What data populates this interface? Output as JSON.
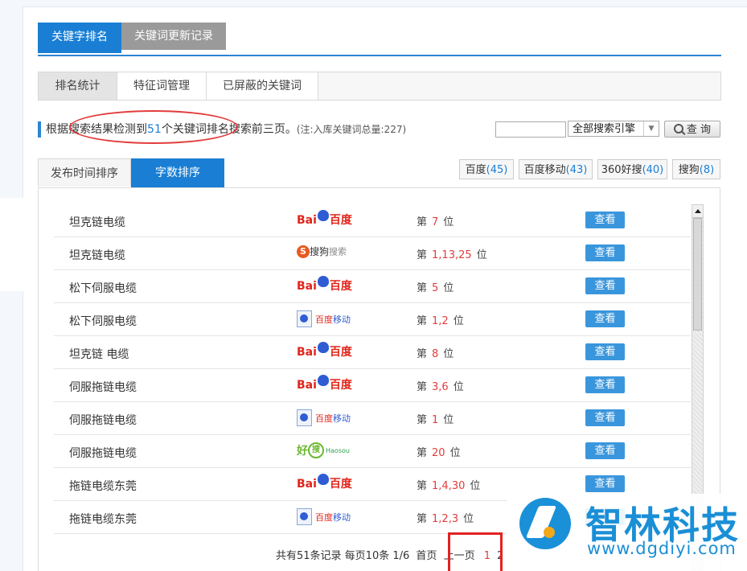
{
  "main_tabs": [
    {
      "label": "关键字排名"
    },
    {
      "label": "关键词更新记录"
    }
  ],
  "sub_tabs": [
    {
      "label": "排名统计"
    },
    {
      "label": "特征词管理"
    },
    {
      "label": "已屏蔽的关键词"
    }
  ],
  "info": {
    "prefix": "根据搜索结果检测到",
    "count": "51",
    "suffix": "个关键词排名搜索前三页。",
    "note": "(注:入库关键词总量:227)"
  },
  "search": {
    "keyword_value": "",
    "engine_selected": "全部搜索引擎",
    "button_label": "查 询"
  },
  "sort_tabs": [
    {
      "label": "发布时间排序"
    },
    {
      "label": "字数排序"
    }
  ],
  "engine_filters": [
    {
      "name": "百度",
      "count": "(45)"
    },
    {
      "name": "百度移动",
      "count": "(43)"
    },
    {
      "name": "360好搜",
      "count": "(40)"
    },
    {
      "name": "搜狗",
      "count": "(8)"
    }
  ],
  "logos": {
    "baidu": {
      "left": "Bai",
      "right": "百度"
    },
    "sogou": {
      "mark": "S",
      "text": "搜狗",
      "text2": "搜索"
    },
    "mobile": {
      "text": "百度",
      "text2": "移动"
    },
    "haosou": {
      "text": "好",
      "mark": "搜",
      "sub": "Haosou"
    }
  },
  "rank_label": {
    "before": "第",
    "after": "位"
  },
  "view_label": "查看",
  "rows": [
    {
      "keyword": "坦克链电缆",
      "engine": "baidu",
      "position": "7"
    },
    {
      "keyword": "坦克链电缆",
      "engine": "sogou",
      "position": "1,13,25"
    },
    {
      "keyword": "松下伺服电缆",
      "engine": "baidu",
      "position": "5"
    },
    {
      "keyword": "松下伺服电缆",
      "engine": "mobile",
      "position": "1,2"
    },
    {
      "keyword": "坦克链 电缆",
      "engine": "baidu",
      "position": "8"
    },
    {
      "keyword": "伺服拖链电缆",
      "engine": "baidu",
      "position": "3,6"
    },
    {
      "keyword": "伺服拖链电缆",
      "engine": "mobile",
      "position": "1"
    },
    {
      "keyword": "伺服拖链电缆",
      "engine": "haosou",
      "position": "20"
    },
    {
      "keyword": "拖链电缆东莞",
      "engine": "baidu",
      "position": "1,4,30"
    },
    {
      "keyword": "拖链电缆东莞",
      "engine": "mobile",
      "position": "1,2,3"
    }
  ],
  "pager": {
    "summary": "共有51条记录 每页10条 1/6",
    "first": "首页",
    "prev": "上一页",
    "current": "1",
    "next": "2"
  },
  "watermark": {
    "name": "智林科技",
    "url": "www.dgdiyi.com"
  }
}
